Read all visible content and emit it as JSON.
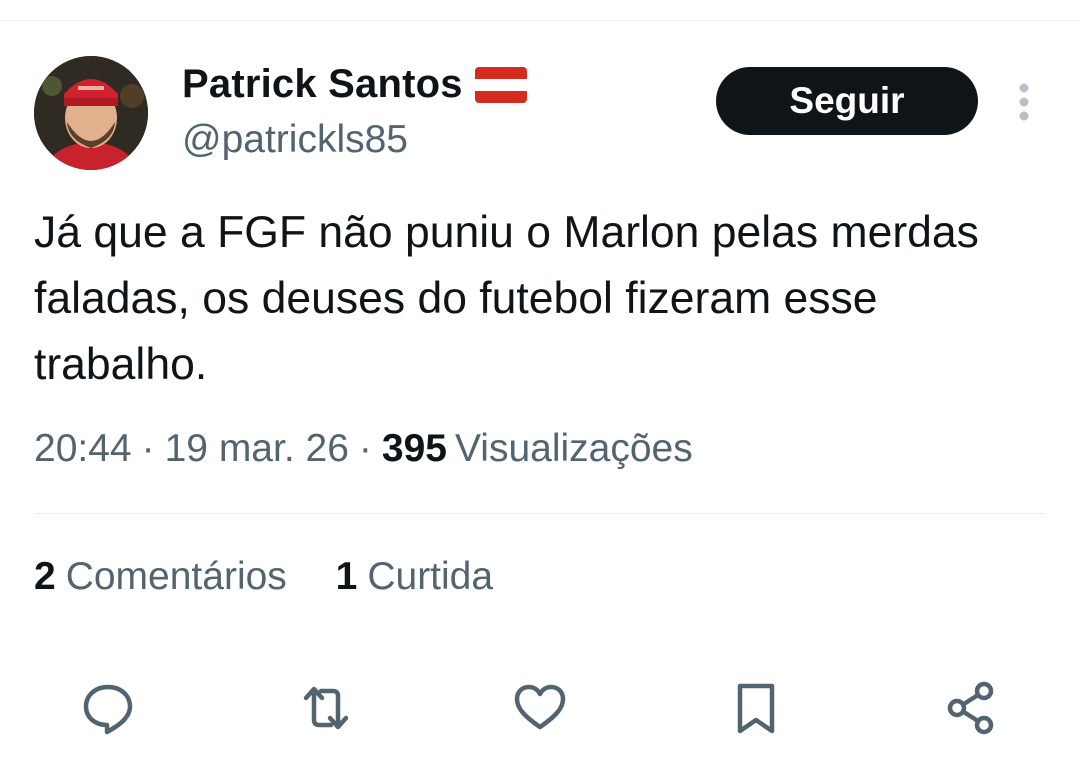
{
  "author": {
    "name": "Patrick Santos",
    "handle": "@patrickls85",
    "avatar_alt": "profile photo"
  },
  "follow_button": {
    "label": "Seguir"
  },
  "tweet": {
    "text": "Já que a FGF não puniu o Marlon pelas merdas faladas, os deuses do futebol fizeram esse trabalho."
  },
  "meta": {
    "time": "20:44",
    "separator": "·",
    "date": "19 mar. 26",
    "views_count": "395",
    "views_label": "Visualizações"
  },
  "stats": {
    "comments_count": "2",
    "comments_label": "Comentários",
    "likes_count": "1",
    "likes_label": "Curtida"
  },
  "actions": [
    "reply-icon",
    "retweet-icon",
    "like-icon",
    "bookmark-icon",
    "share-icon"
  ],
  "colors": {
    "text": "#0f1419",
    "secondary": "#536471",
    "button_bg": "#0f1419",
    "divider": "#eff3f4",
    "flag_red": "#d52b1e"
  }
}
